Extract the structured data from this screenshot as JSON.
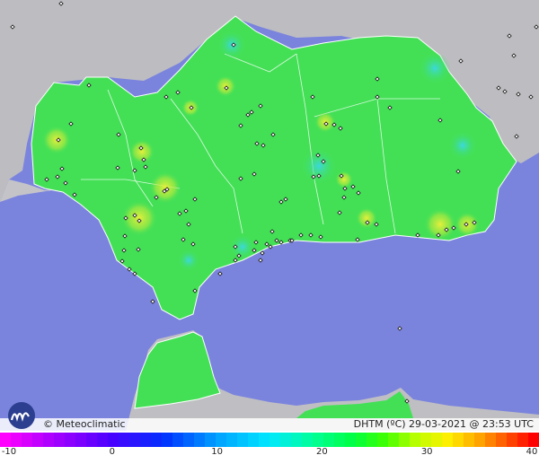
{
  "map": {
    "credit": "© Meteoclimatic",
    "variable": "DHTM (ºC)",
    "date": "29-03-2021",
    "time": "23:53 UTC",
    "colors": {
      "sea": "#7b84dd",
      "land_outside": "#b9b9bd",
      "region_base": "#43e056",
      "warm_spot": "#d8e83a",
      "cool_spot": "#48d9e8",
      "border": "#ffffff",
      "station": "#111111"
    }
  },
  "scale": {
    "min": -10,
    "max": 40,
    "tick_labels": [
      "-10",
      "0",
      "10",
      "20",
      "30",
      "40"
    ]
  }
}
